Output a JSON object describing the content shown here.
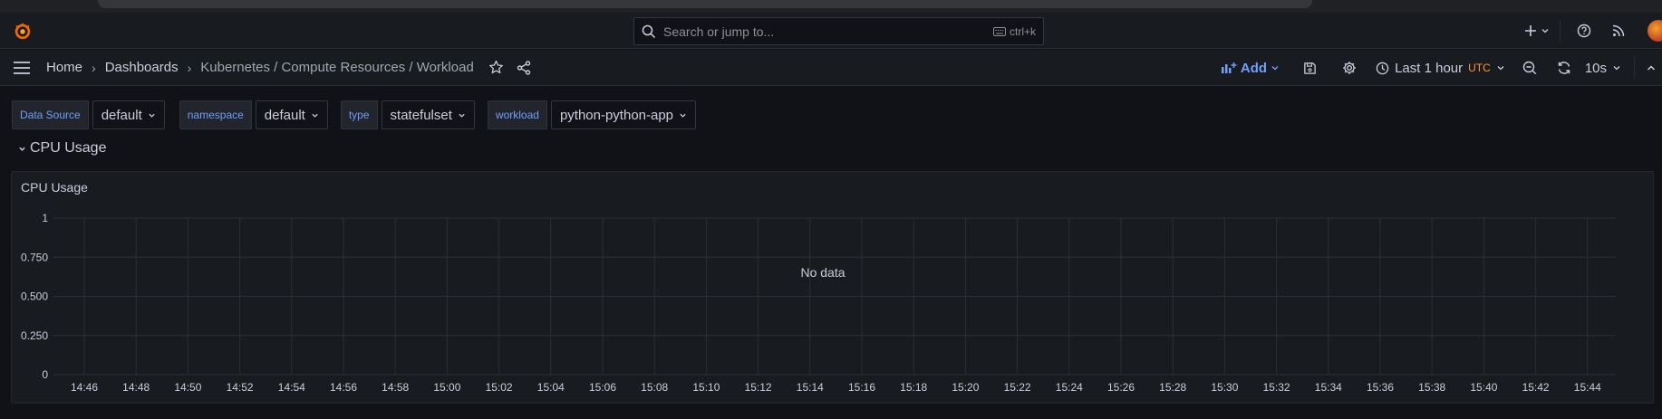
{
  "search": {
    "placeholder": "Search or jump to...",
    "shortcut": "ctrl+k"
  },
  "breadcrumbs": [
    {
      "label": "Home"
    },
    {
      "label": "Dashboards"
    },
    {
      "label": "Kubernetes / Compute Resources / Workload"
    }
  ],
  "toolbar": {
    "add_label": "Add",
    "time_range": "Last 1 hour",
    "timezone": "UTC",
    "refresh_interval": "10s"
  },
  "variables": [
    {
      "label": "Data Source",
      "value": "default"
    },
    {
      "label": "namespace",
      "value": "default"
    },
    {
      "label": "type",
      "value": "statefulset"
    },
    {
      "label": "workload",
      "value": "python-python-app"
    }
  ],
  "row": {
    "title": "CPU Usage"
  },
  "panel": {
    "title": "CPU Usage",
    "empty_text": "No data"
  },
  "colors": {
    "accent": "#6e9fff",
    "utc": "#ff9830",
    "background": "#111217",
    "panel": "#181b1f"
  },
  "chart_data": {
    "type": "line",
    "title": "CPU Usage",
    "series": [],
    "y_ticks": [
      "0",
      "0.250",
      "0.500",
      "0.750",
      "1"
    ],
    "ylim": [
      0,
      1
    ],
    "x_ticks": [
      "14:46",
      "14:48",
      "14:50",
      "14:52",
      "14:54",
      "14:56",
      "14:58",
      "15:00",
      "15:02",
      "15:04",
      "15:06",
      "15:08",
      "15:10",
      "15:12",
      "15:14",
      "15:16",
      "15:18",
      "15:20",
      "15:22",
      "15:24",
      "15:26",
      "15:28",
      "15:30",
      "15:32",
      "15:34",
      "15:36",
      "15:38",
      "15:40",
      "15:42",
      "15:44"
    ],
    "grid": true,
    "empty_text": "No data"
  }
}
